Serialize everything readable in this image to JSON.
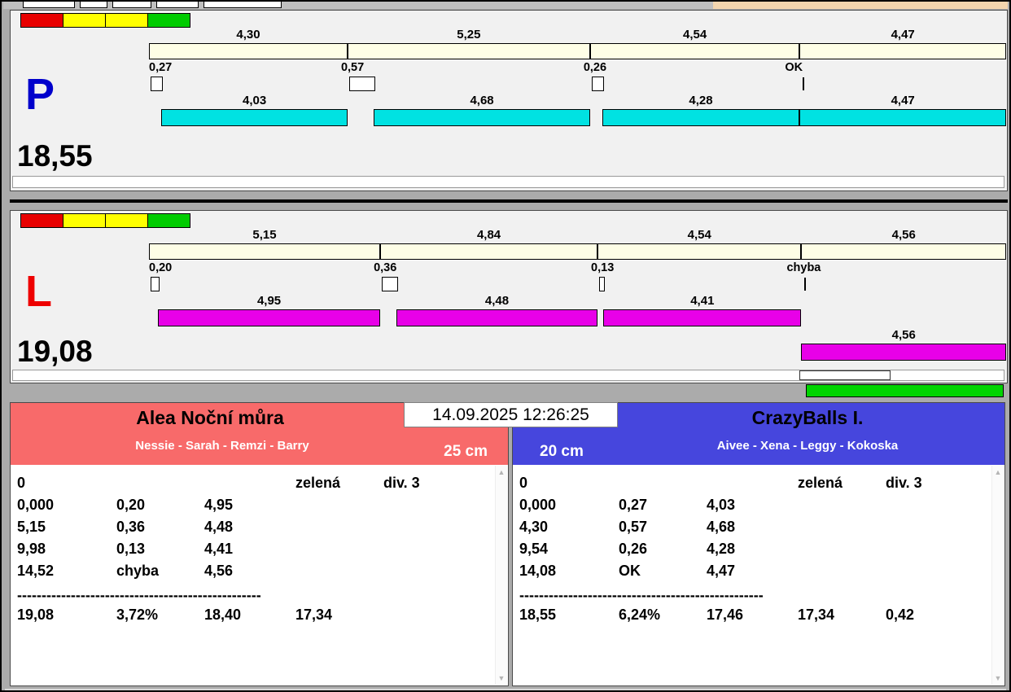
{
  "window": {
    "timestamp": "14.09.2025 12:26:25"
  },
  "traffic_colors": [
    "#e80000",
    "#ffff00",
    "#ffff00",
    "#00cc00"
  ],
  "lanes": [
    {
      "id": "P",
      "letter": "P",
      "letter_color": "#0000cc",
      "bar_color": "#00e2e2",
      "total": "18,55",
      "segments": [
        "4,30",
        "5,25",
        "4,54",
        "4,47"
      ],
      "crosses": [
        "0,27",
        "0,57",
        "0,26",
        "OK"
      ],
      "runs": [
        "4,03",
        "4,68",
        "4,28",
        "4,47"
      ]
    },
    {
      "id": "L",
      "letter": "L",
      "letter_color": "#ee0000",
      "bar_color": "#e800e8",
      "total": "19,08",
      "segments": [
        "5,15",
        "4,84",
        "4,54",
        "4,56"
      ],
      "crosses": [
        "0,20",
        "0,36",
        "0,13",
        "chyba"
      ],
      "runs": [
        "4,95",
        "4,48",
        "4,41"
      ],
      "rerun": {
        "time": "4,56",
        "segment": 3
      }
    }
  ],
  "teams": [
    {
      "name": "Alea Noční můra",
      "members": "Nessie - Sarah - Remzi - Barry",
      "height": "25 cm",
      "header_color": "#f86a6a",
      "rows": [
        [
          "0",
          "",
          "",
          "zelená",
          "div. 3"
        ],
        [
          "0,000",
          "0,20",
          "4,95",
          "",
          ""
        ],
        [
          "5,15",
          "0,36",
          "4,48",
          "",
          ""
        ],
        [
          "9,98",
          "0,13",
          "4,41",
          "",
          ""
        ],
        [
          "14,52",
          "chyba",
          "4,56",
          "",
          ""
        ],
        [
          "--------------------------------------------------"
        ],
        [
          "19,08",
          "3,72%",
          "18,40",
          "17,34",
          ""
        ]
      ]
    },
    {
      "name": "CrazyBalls I.",
      "members": "Aivee - Xena - Leggy - Kokoska",
      "height": "20 cm",
      "header_color": "#4646dd",
      "rows": [
        [
          "0",
          "",
          "",
          "zelená",
          "div. 3"
        ],
        [
          "0,000",
          "0,27",
          "4,03",
          "",
          ""
        ],
        [
          "4,30",
          "0,57",
          "4,68",
          "",
          ""
        ],
        [
          "9,54",
          "0,26",
          "4,28",
          "",
          ""
        ],
        [
          "14,08",
          "OK",
          "4,47",
          "",
          ""
        ],
        [
          "--------------------------------------------------"
        ],
        [
          "18,55",
          "6,24%",
          "17,46",
          "17,34",
          "0,42"
        ]
      ]
    }
  ]
}
